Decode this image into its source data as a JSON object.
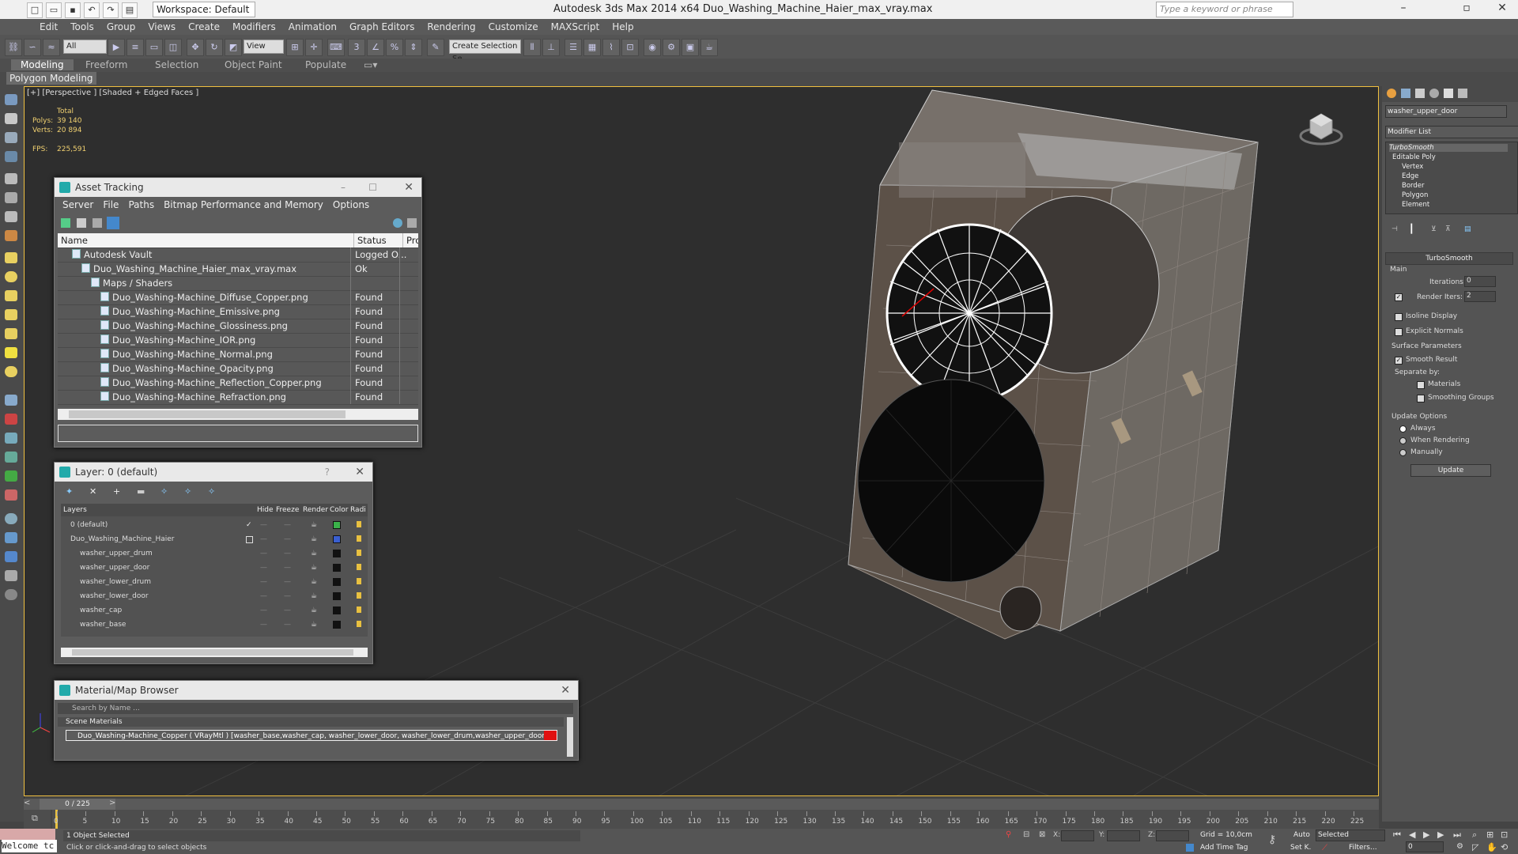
{
  "app": {
    "title": "Autodesk 3ds Max  2014 x64     Duo_Washing_Machine_Haier_max_vray.max",
    "workspace": "Workspace: Default",
    "search_placeholder": "Type a keyword or phrase"
  },
  "menubar": [
    "Edit",
    "Tools",
    "Group",
    "Views",
    "Create",
    "Modifiers",
    "Animation",
    "Graph Editors",
    "Rendering",
    "Customize",
    "MAXScript",
    "Help"
  ],
  "toolbar": {
    "filter": "All",
    "refcoord": "View",
    "selection_set": "Create Selection Se"
  },
  "ribbon": {
    "tabs": [
      "Modeling",
      "Freeform",
      "Selection",
      "Object Paint",
      "Populate"
    ],
    "active_tab": "Modeling",
    "panel": "Polygon Modeling"
  },
  "viewport": {
    "label": "[+] [Perspective ] [Shaded + Edged Faces ]",
    "stats": {
      "total_label": "Total",
      "polys_label": "Polys:",
      "polys": "39 140",
      "verts_label": "Verts:",
      "verts": "20 894",
      "fps_label": "FPS:",
      "fps": "225,591"
    }
  },
  "asset_tracking": {
    "title": "Asset Tracking",
    "menu": [
      "Server",
      "File",
      "Paths",
      "Bitmap Performance and Memory",
      "Options"
    ],
    "columns": [
      "Name",
      "Status",
      "Prox"
    ],
    "rows": [
      {
        "name": "Autodesk Vault",
        "status": "Logged O...",
        "indent": 1
      },
      {
        "name": "Duo_Washing_Machine_Haier_max_vray.max",
        "status": "Ok",
        "indent": 2
      },
      {
        "name": "Maps / Shaders",
        "status": "",
        "indent": 3
      },
      {
        "name": "Duo_Washing-Machine_Diffuse_Copper.png",
        "status": "Found",
        "indent": 4
      },
      {
        "name": "Duo_Washing-Machine_Emissive.png",
        "status": "Found",
        "indent": 4
      },
      {
        "name": "Duo_Washing-Machine_Glossiness.png",
        "status": "Found",
        "indent": 4
      },
      {
        "name": "Duo_Washing-Machine_IOR.png",
        "status": "Found",
        "indent": 4
      },
      {
        "name": "Duo_Washing-Machine_Normal.png",
        "status": "Found",
        "indent": 4
      },
      {
        "name": "Duo_Washing-Machine_Opacity.png",
        "status": "Found",
        "indent": 4
      },
      {
        "name": "Duo_Washing-Machine_Reflection_Copper.png",
        "status": "Found",
        "indent": 4
      },
      {
        "name": "Duo_Washing-Machine_Refraction.png",
        "status": "Found",
        "indent": 4
      }
    ]
  },
  "layer_window": {
    "title": "Layer: 0 (default)",
    "columns": [
      "Layers",
      "Hide",
      "Freeze",
      "Render",
      "Color",
      "Radi"
    ],
    "rows": [
      {
        "name": "0 (default)",
        "color": "#3bb24a",
        "indent": 1
      },
      {
        "name": "Duo_Washing_Machine_Haier",
        "color": "#3a5fd0",
        "indent": 1
      },
      {
        "name": "washer_upper_drum",
        "color": "#111111",
        "indent": 2
      },
      {
        "name": "washer_upper_door",
        "color": "#111111",
        "indent": 2
      },
      {
        "name": "washer_lower_drum",
        "color": "#111111",
        "indent": 2
      },
      {
        "name": "washer_lower_door",
        "color": "#111111",
        "indent": 2
      },
      {
        "name": "washer_cap",
        "color": "#111111",
        "indent": 2
      },
      {
        "name": "washer_base",
        "color": "#111111",
        "indent": 2
      }
    ]
  },
  "material_browser": {
    "title": "Material/Map Browser",
    "search_placeholder": "Search by Name ...",
    "section": "Scene Materials",
    "item": "Duo_Washing-Machine_Copper ( VRayMtl ) [washer_base,washer_cap, washer_lower_door, washer_lower_drum,washer_upper_door, washer_upper_drum]"
  },
  "command_panel": {
    "object_name": "washer_upper_door",
    "modifier_list": "Modifier List",
    "stack": [
      "TurboSmooth",
      "Editable Poly",
      "Vertex",
      "Edge",
      "Border",
      "Polygon",
      "Element"
    ],
    "turbosmooth": {
      "title": "TurboSmooth",
      "main": "Main",
      "iterations_label": "Iterations:",
      "iterations": "0",
      "render_iters_label": "Render Iters:",
      "render_iters": "2",
      "isoline": "Isoline Display",
      "explicit": "Explicit Normals",
      "surface": "Surface Parameters",
      "smooth_result": "Smooth Result",
      "separate_by": "Separate by:",
      "materials": "Materials",
      "smoothing_groups": "Smoothing Groups",
      "update_options": "Update Options",
      "always": "Always",
      "when_rendering": "When Rendering",
      "manually": "Manually",
      "update_button": "Update"
    }
  },
  "timeline": {
    "frame": "0 / 225",
    "ticks": [
      "0",
      "5",
      "10",
      "15",
      "20",
      "25",
      "30",
      "35",
      "40",
      "45",
      "50",
      "55",
      "60",
      "65",
      "70",
      "75",
      "80",
      "85",
      "90",
      "95",
      "100",
      "105",
      "110",
      "115",
      "120",
      "125",
      "130",
      "135",
      "140",
      "145",
      "150",
      "155",
      "160",
      "165",
      "170",
      "175",
      "180",
      "185",
      "190",
      "195",
      "200",
      "205",
      "210",
      "215",
      "220",
      "225"
    ]
  },
  "status": {
    "welcome": "Welcome tc",
    "selected": "1 Object Selected",
    "hint": "Click or click-and-drag to select objects",
    "x_label": "X:",
    "y_label": "Y:",
    "z_label": "Z:",
    "grid": "Grid = 10,0cm",
    "add_time_tag": "Add Time Tag",
    "auto": "Auto",
    "selected_dropdown": "Selected",
    "setk": "Set K.",
    "filters": "Filters...",
    "frame_field": "0"
  }
}
